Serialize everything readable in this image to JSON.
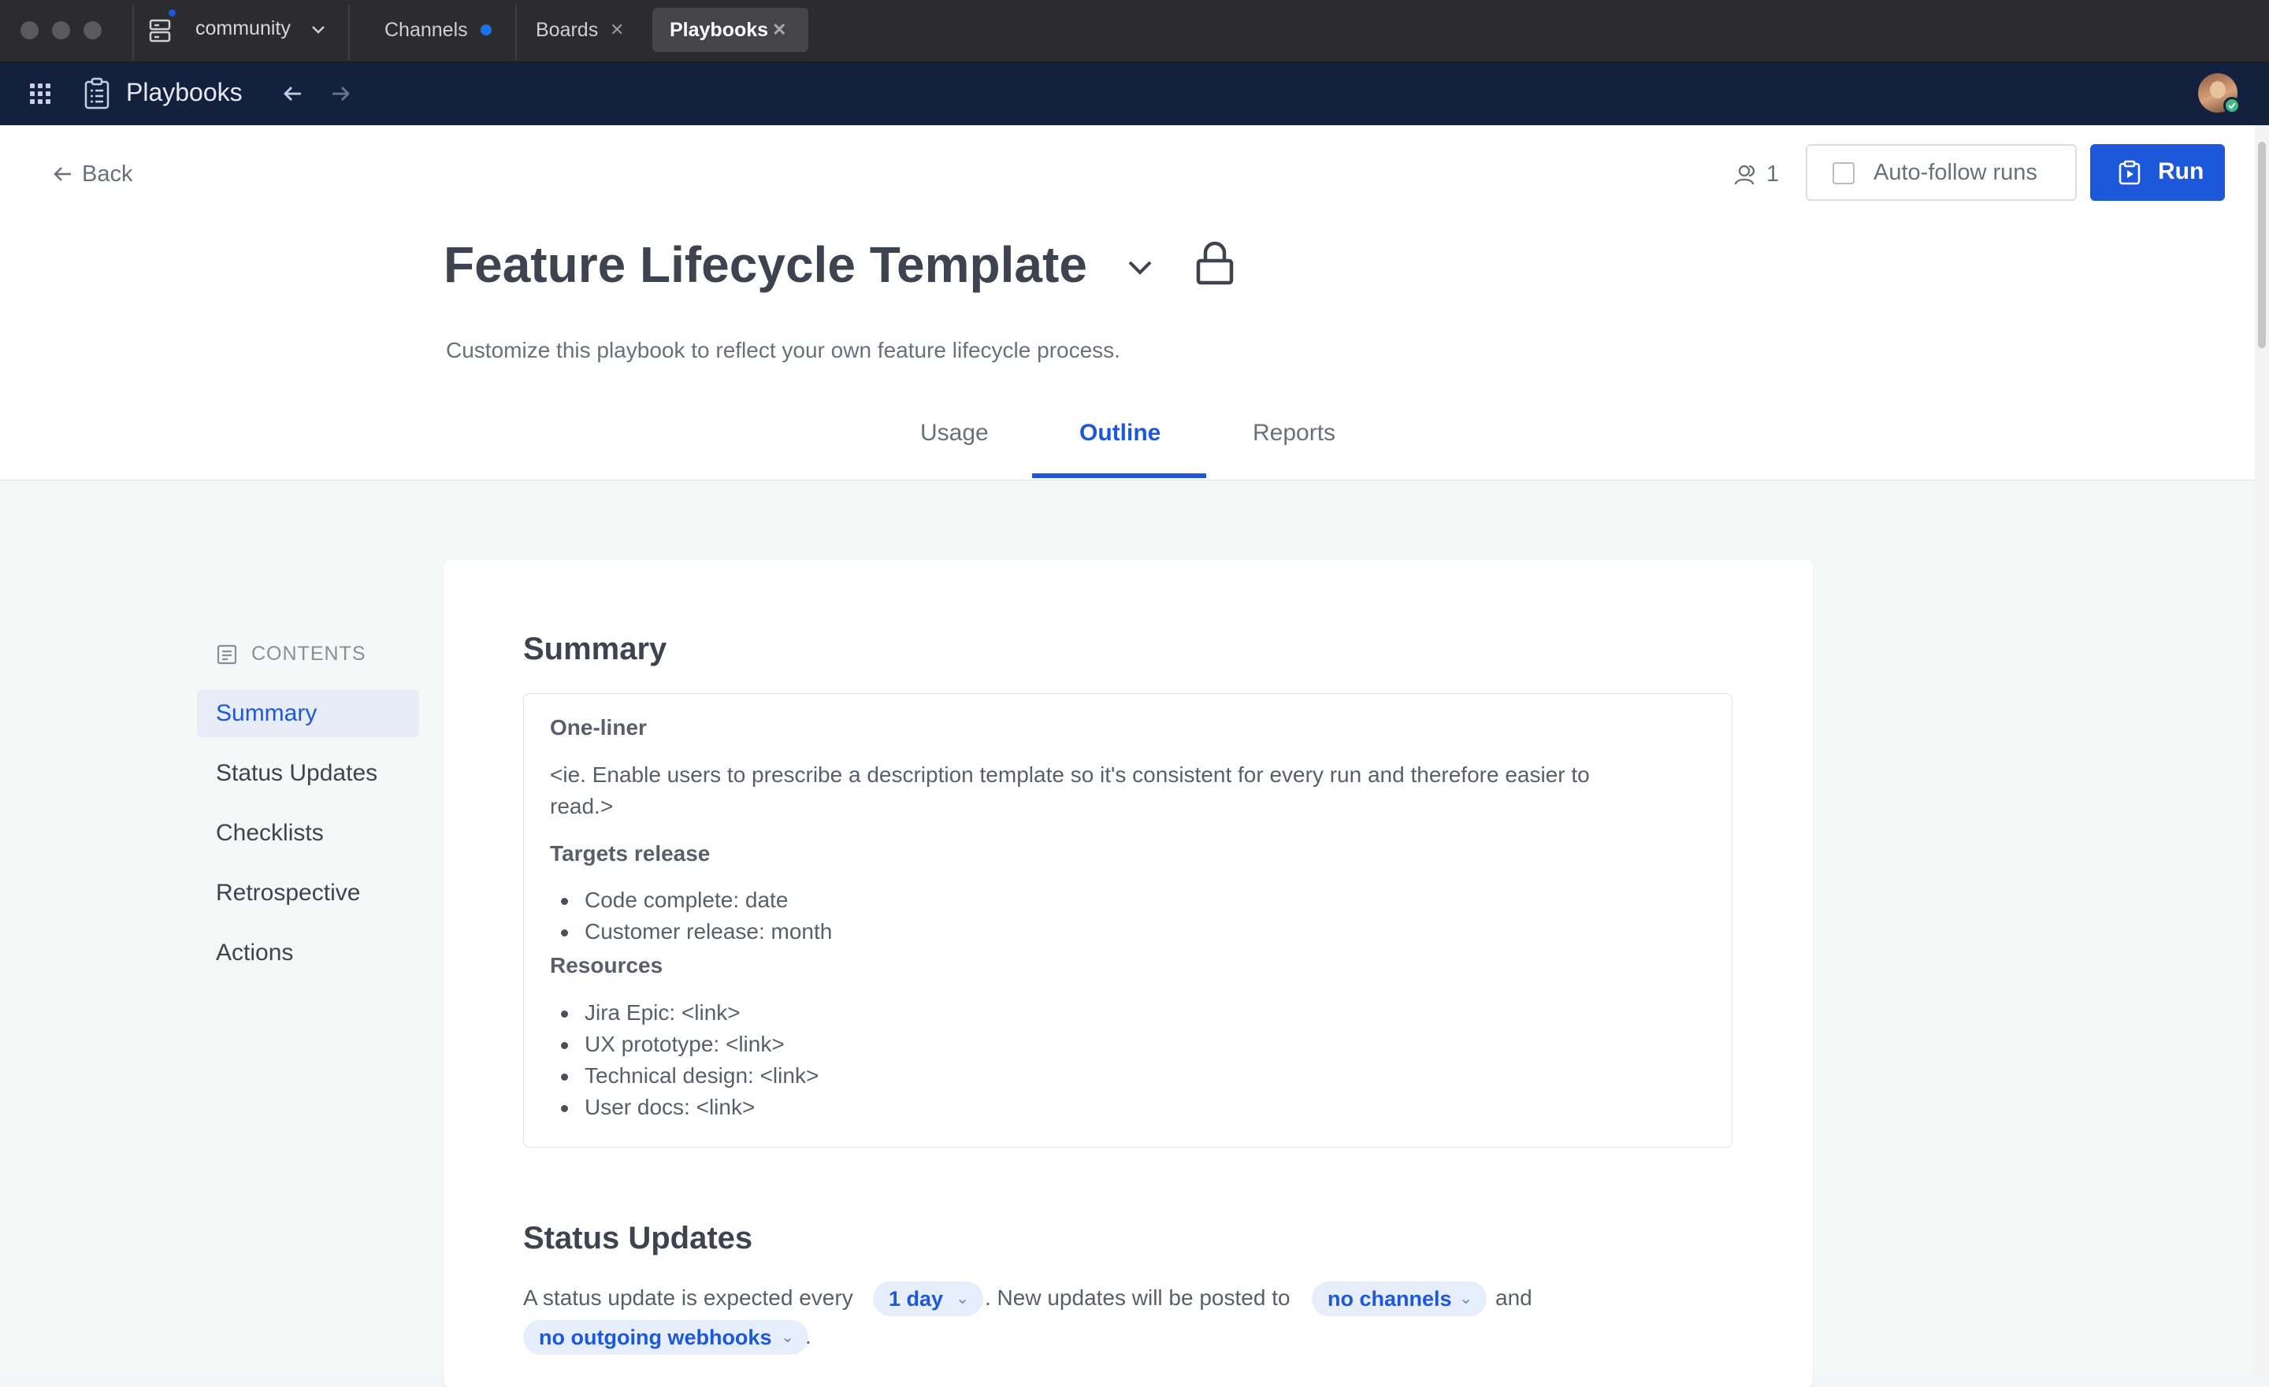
{
  "titlebar": {
    "workspace": "community",
    "tabs": [
      {
        "label": "Channels",
        "unread": true
      },
      {
        "label": "Boards"
      },
      {
        "label": "Playbooks",
        "active": true
      }
    ]
  },
  "appbar": {
    "title": "Playbooks"
  },
  "header": {
    "back_label": "Back",
    "member_count": "1",
    "auto_follow_label": "Auto-follow runs",
    "run_label": "Run",
    "title": "Feature Lifecycle Template",
    "description": "Customize this playbook to reflect your own feature lifecycle process.",
    "tabs": [
      "Usage",
      "Outline",
      "Reports"
    ],
    "active_tab": "Outline"
  },
  "toc": {
    "heading": "CONTENTS",
    "items": [
      "Summary",
      "Status Updates",
      "Checklists",
      "Retrospective",
      "Actions"
    ],
    "active": "Summary"
  },
  "summary": {
    "heading": "Summary",
    "oneliner_heading": "One-liner",
    "oneliner_line1": "<ie. Enable users to prescribe a description template so it's consistent for every run and therefore easier to",
    "oneliner_line2": "read.>",
    "targets_heading": "Targets release",
    "targets": [
      "Code complete: date",
      "Customer release: month"
    ],
    "resources_heading": "Resources",
    "resources": [
      "Jira Epic: <link>",
      "UX prototype: <link>",
      "Technical design: <link>",
      "User docs: <link>"
    ]
  },
  "status_updates": {
    "heading": "Status Updates",
    "text1": "A status update is expected every",
    "interval": "1 day",
    "text2": ". New updates will be posted to",
    "channels": "no channels",
    "text3": "and",
    "webhooks": "no outgoing webhooks",
    "text4": "."
  },
  "colors": {
    "accent": "#1c58d9",
    "appbar_bg": "#14213e",
    "titlebar_bg": "#2c2c2e"
  }
}
